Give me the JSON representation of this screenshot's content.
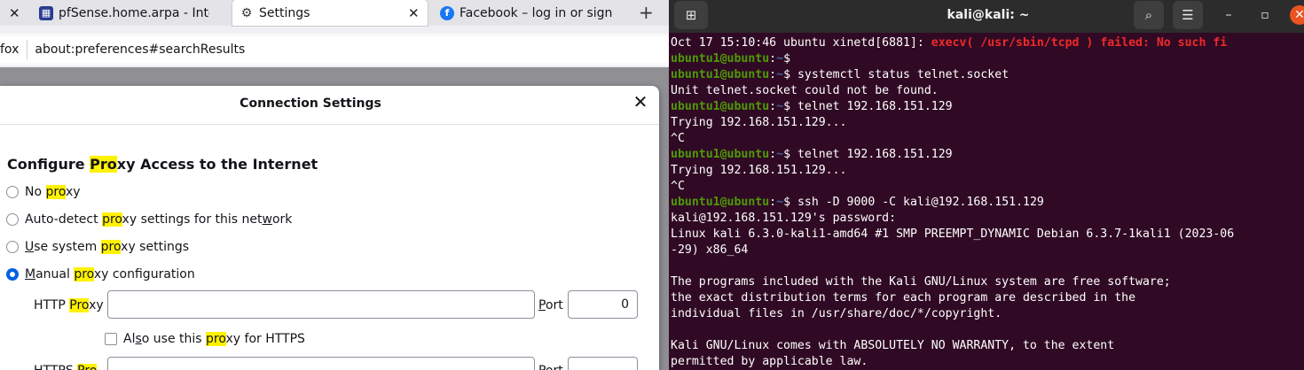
{
  "firefox": {
    "tabs": [
      {
        "label": "pfSense.home.arpa - Inte",
        "icon": "pfsense-icon"
      },
      {
        "label": "Settings",
        "icon": "gear-icon"
      },
      {
        "label": "Facebook – log in or sign",
        "icon": "facebook-icon"
      }
    ],
    "new_tab": "+",
    "close_glyph": "✕",
    "url_prefix": "fox",
    "url": "about:preferences#searchResults",
    "dialog": {
      "title": "Connection Settings",
      "section": {
        "pre": "Configure ",
        "hl": "Pro",
        "post": "xy Access to the Internet"
      },
      "options": [
        {
          "pre": "No ",
          "hl": "pro",
          "post": "xy",
          "selected": false
        },
        {
          "pre": "Auto-detect ",
          "hl": "pro",
          "post": "xy settings for this net",
          "post2": "w",
          "post3": "ork",
          "selected": false
        },
        {
          "pre": "",
          "u": "U",
          "pre2": "se system ",
          "hl": "pro",
          "post": "xy settings",
          "selected": false
        },
        {
          "pre": "",
          "u": "M",
          "pre2": "anual ",
          "hl": "pro",
          "post": "xy configuration",
          "selected": true
        }
      ],
      "http_proxy": {
        "pre": "HTTP ",
        "hl": "Pro",
        "post": "xy",
        "u": "x",
        "value": ""
      },
      "port_label": {
        "u": "P",
        "rest": "ort"
      },
      "port_value": "0",
      "also_https": {
        "pre": "Al",
        "u": "s",
        "mid": "o use this ",
        "hl": "pro",
        "post": "xy for HTTPS",
        "checked": false
      }
    }
  },
  "terminal": {
    "title": "kali@kali: ~",
    "prompt_user": "ubuntu1@ubuntu",
    "prompt_path": "~",
    "lines": [
      {
        "type": "err",
        "pre": "Oct 17 15:10:46 ubuntu xinetd[6881]: ",
        "err": "execv( /usr/sbin/tcpd ) failed: No such fi"
      },
      {
        "type": "prompt",
        "cmd": ""
      },
      {
        "type": "prompt",
        "cmd": "systemctl status telnet.socket"
      },
      {
        "type": "text",
        "text": "Unit telnet.socket could not be found."
      },
      {
        "type": "prompt",
        "cmd": "telnet 192.168.151.129"
      },
      {
        "type": "text",
        "text": "Trying 192.168.151.129..."
      },
      {
        "type": "text",
        "text": "^C"
      },
      {
        "type": "prompt",
        "cmd": "telnet 192.168.151.129"
      },
      {
        "type": "text",
        "text": "Trying 192.168.151.129..."
      },
      {
        "type": "text",
        "text": "^C"
      },
      {
        "type": "prompt",
        "cmd": "ssh -D 9000 -C kali@192.168.151.129"
      },
      {
        "type": "text",
        "text": "kali@192.168.151.129's password:"
      },
      {
        "type": "text",
        "text": "Linux kali 6.3.0-kali1-amd64 #1 SMP PREEMPT_DYNAMIC Debian 6.3.7-1kali1 (2023-06"
      },
      {
        "type": "text",
        "text": "-29) x86_64"
      },
      {
        "type": "text",
        "text": ""
      },
      {
        "type": "text",
        "text": "The programs included with the Kali GNU/Linux system are free software;"
      },
      {
        "type": "text",
        "text": "the exact distribution terms for each program are described in the"
      },
      {
        "type": "text",
        "text": "individual files in /usr/share/doc/*/copyright."
      },
      {
        "type": "text",
        "text": ""
      },
      {
        "type": "text",
        "text": "Kali GNU/Linux comes with ABSOLUTELY NO WARRANTY, to the extent"
      },
      {
        "type": "text",
        "text": "permitted by applicable law."
      }
    ]
  },
  "colors": {
    "accent": "#0061e0",
    "highlight": "#fff200",
    "terminal_bg": "#300a24",
    "prompt_green": "#4e9a06",
    "prompt_blue": "#3465a4",
    "error_red": "#ef2929"
  }
}
